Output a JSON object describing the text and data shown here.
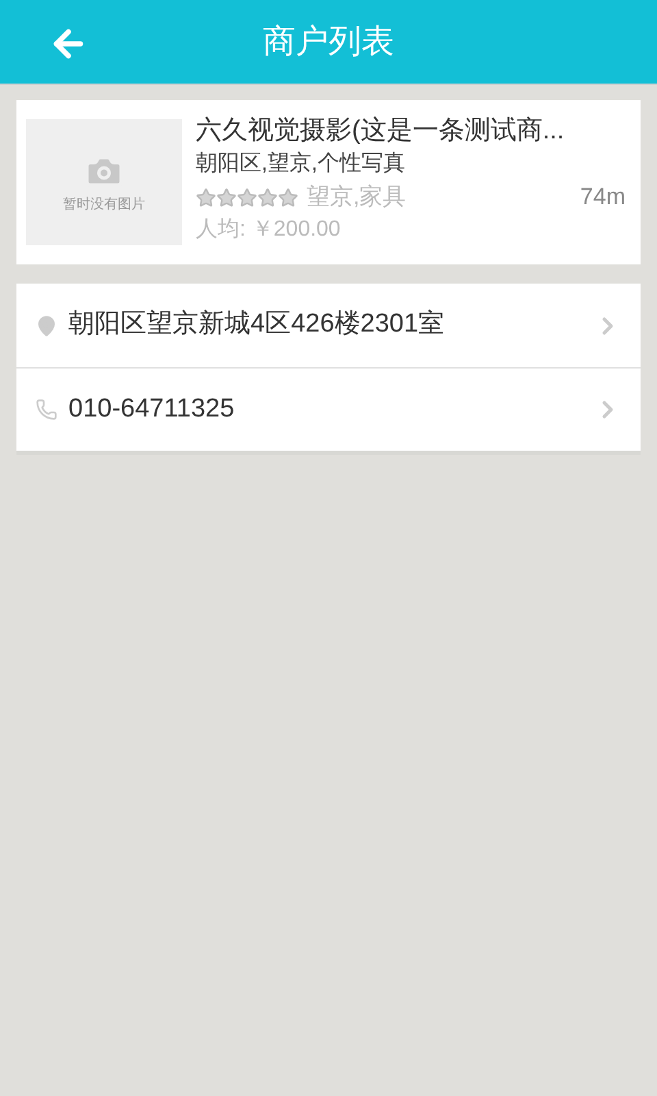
{
  "header": {
    "title": "商户列表"
  },
  "merchant": {
    "image_placeholder": "暂时没有图片",
    "name": "六久视觉摄影(这是一条测试商...",
    "tags": "朝阳区,望京,个性写真",
    "stars": 0,
    "area": "望京,家具",
    "distance": "74m",
    "price": "人均: ￥200.00"
  },
  "contacts": [
    {
      "kind": "address",
      "text": "朝阳区望京新城4区426楼2301室"
    },
    {
      "kind": "phone",
      "text": "010-64711325"
    }
  ]
}
